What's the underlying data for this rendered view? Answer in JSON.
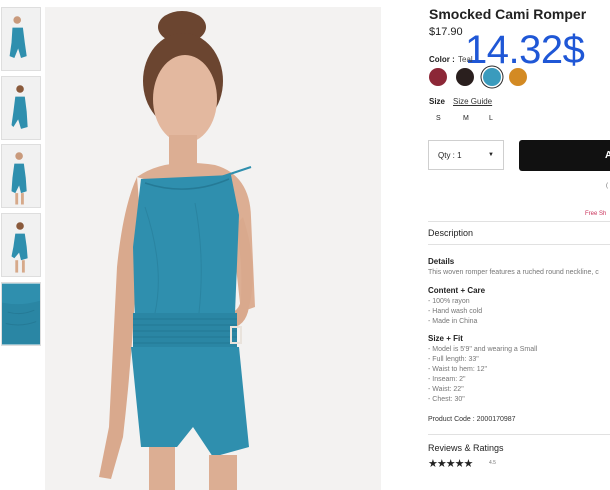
{
  "product": {
    "title": "Smocked Cami Romper",
    "price": "$17.90",
    "overlay_price": "14.32$"
  },
  "color": {
    "label": "Color :",
    "selected": "Teal",
    "swatches": [
      {
        "name": "Burgundy",
        "hex": "#8c2737"
      },
      {
        "name": "Black",
        "hex": "#2a1f1e"
      },
      {
        "name": "Teal",
        "hex": "#3a9bbd"
      },
      {
        "name": "Mustard",
        "hex": "#d38a23"
      }
    ]
  },
  "size": {
    "label": "Size",
    "guide_label": "Size Guide",
    "options": [
      "S",
      "M",
      "L"
    ]
  },
  "quantity": {
    "label": "Qty : 1",
    "caret": "▼"
  },
  "cart": {
    "button_label": "A",
    "note": "(",
    "free_shipping": "Free Sh"
  },
  "sections": {
    "description": "Description",
    "details": {
      "title": "Details",
      "text": "This woven romper features a ruched round neckline, c"
    },
    "content_care": {
      "title": "Content + Care",
      "items": [
        "- 100% rayon",
        "- Hand wash cold",
        "- Made in China"
      ]
    },
    "size_fit": {
      "title": "Size + Fit",
      "items": [
        "- Model is 5'9\" and wearing a Small",
        "- Full length: 33\"",
        "- Waist to hem: 12\"",
        "- Inseam: 2\"",
        "- Waist: 22\"",
        "- Chest: 30\""
      ]
    },
    "product_code": "Product Code : 2000170987"
  },
  "reviews": {
    "title": "Reviews & Ratings",
    "stars": "★★★★★",
    "rating": 4.5,
    "rating_text": "4.5"
  },
  "colors": {
    "accent_blue": "#1f57d6",
    "romper_teal": "#2f8fae",
    "button_black": "#111111",
    "free_ship_pink": "#c9325a"
  }
}
